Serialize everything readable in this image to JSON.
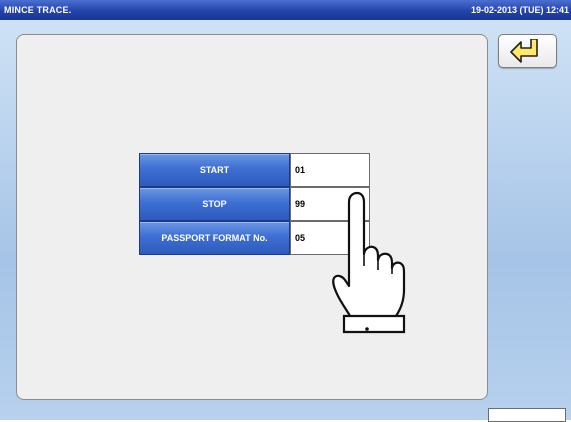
{
  "header": {
    "title": "MINCE TRACE.",
    "datetime": "19-02-2013 (TUE) 12:41"
  },
  "back_button": {
    "icon": "return-arrow-icon"
  },
  "fields": [
    {
      "label": "START",
      "value": "01"
    },
    {
      "label": "STOP",
      "value": "99"
    },
    {
      "label": "PASSPORT FORMAT No.",
      "value": "05"
    }
  ],
  "colors": {
    "titlebar": "#2443a8",
    "label_button": "#3e6fd2",
    "panel_background": "#efefef",
    "screen_background": "#b7d1ee"
  }
}
